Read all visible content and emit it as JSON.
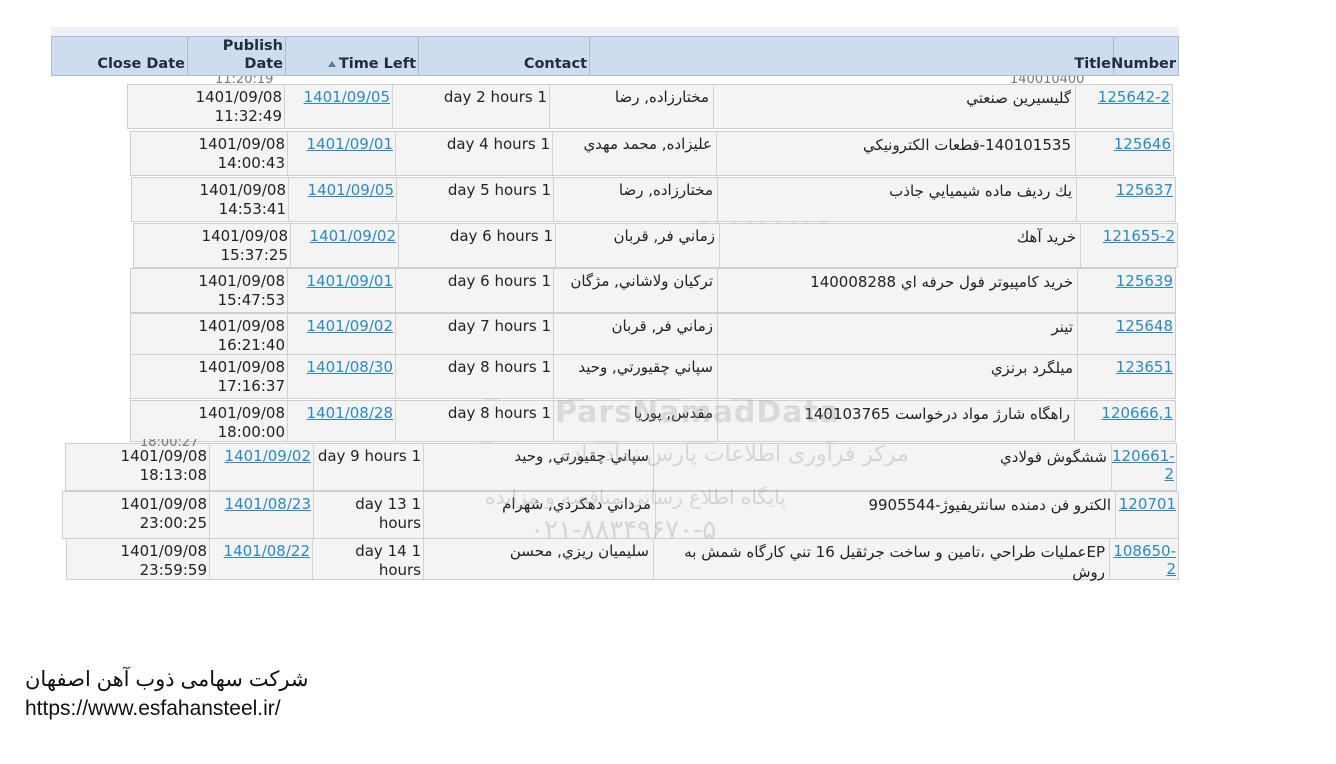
{
  "columns": {
    "close_date": "Close Date",
    "publish_date_line1": "Publish",
    "publish_date_line2": "Date",
    "time_left": "Time Left",
    "contact": "Contact",
    "title": "Title",
    "number": "Number"
  },
  "sort_indicator": "sort-ascending-icon",
  "rows": [
    {
      "number": "125642-2",
      "title": "گليسيرين صنعتي",
      "contact": "مختارزاده, رضا",
      "time_left": "1 day 2 hours",
      "publish": "1401/09/05",
      "close_date": "1401/09/08",
      "close_time": "11:32:49"
    },
    {
      "number": "125646",
      "title": "140101535-قطعات الكترونيكي",
      "contact": "عليزاده, محمد مهدي",
      "time_left": "1 day 4 hours",
      "publish": "1401/09/01",
      "close_date": "1401/09/08",
      "close_time": "14:00:43"
    },
    {
      "number": "125637",
      "title": "يك رديف ماده شيميايي جاذب",
      "contact": "مختارزاده, رضا",
      "time_left": "1 day 5 hours",
      "publish": "1401/09/05",
      "close_date": "1401/09/08",
      "close_time": "14:53:41"
    },
    {
      "number": "121655-2",
      "title": "خريد آهك",
      "contact": "زماني فر, قربان",
      "time_left": "1 day 6 hours",
      "publish": "1401/09/02",
      "close_date": "1401/09/08",
      "close_time": "15:37:25"
    },
    {
      "number": "125639",
      "title": "خريد كامپيوتر فول حرفه اي 140008288",
      "contact": "تركيان ولاشاني, مژگان",
      "time_left": "1 day 6 hours",
      "publish": "1401/09/01",
      "close_date": "1401/09/08",
      "close_time": "15:47:53"
    },
    {
      "number": "125648",
      "title": "تينر",
      "contact": "زماني فر, قربان",
      "time_left": "1 day 7 hours",
      "publish": "1401/09/02",
      "close_date": "1401/09/08",
      "close_time": "16:21:40"
    },
    {
      "number": "123651",
      "title": "ميلگرد برنزي",
      "contact": "سپاني چقيورتي, وحيد",
      "time_left": "1 day 8 hours",
      "publish": "1401/08/30",
      "close_date": "1401/09/08",
      "close_time": "17:16:37"
    },
    {
      "number": "120666,1",
      "title": "راهگاه شارژ مواد درخواست 140103765",
      "contact": "مقدس, پوريا",
      "time_left": "1 day 8 hours",
      "publish": "1401/08/28",
      "close_date": "1401/09/08",
      "close_time": "18:00:00"
    },
    {
      "number": "120661-2",
      "title": "ششگوش فولادي",
      "contact": "سپاني چقيورتي, وحيد",
      "time_left": "1 day 9 hours",
      "publish": "1401/09/02",
      "close_date": "1401/09/08",
      "close_time": "18:13:08"
    },
    {
      "number": "120701",
      "title": "الكترو فن دمنده سانتريفيوژ-9905544",
      "contact": "مرداني دهكردي, شهرام",
      "time_left": "1 day 13 hours",
      "publish": "1401/08/23",
      "close_date": "1401/09/08",
      "close_time": "23:00:25"
    },
    {
      "number": "108650-2",
      "title": "EPعمليات طراحي ،تامين و ساخت جرثقيل 16 تني كارگاه شمش به روش",
      "contact": "سليميان ريزي, محسن",
      "time_left": "1 day 14 hours",
      "publish": "1401/08/22",
      "close_date": "1401/09/08",
      "close_time": "23:59:59"
    }
  ],
  "ghost_text": {
    "top_close": "11:20:19",
    "top_number": "140010400",
    "mid_close": "18:00:27"
  },
  "watermark": {
    "brand": "ParsNamadData",
    "line1": "مرکز فرآوری اطلاعات پارس نماد داده",
    "line2": "پایگاه اطلاع رسانی مناقصه و مزایده",
    "phone": "۰۲۱-۸۸۳۴۹۶۷۰-۵",
    "digits": "010101 0001 1010 010 0"
  },
  "footer": {
    "company": "شرکت سهامی ذوب آهن اصفهان",
    "url": "https://www.esfahansteel.ir/"
  }
}
